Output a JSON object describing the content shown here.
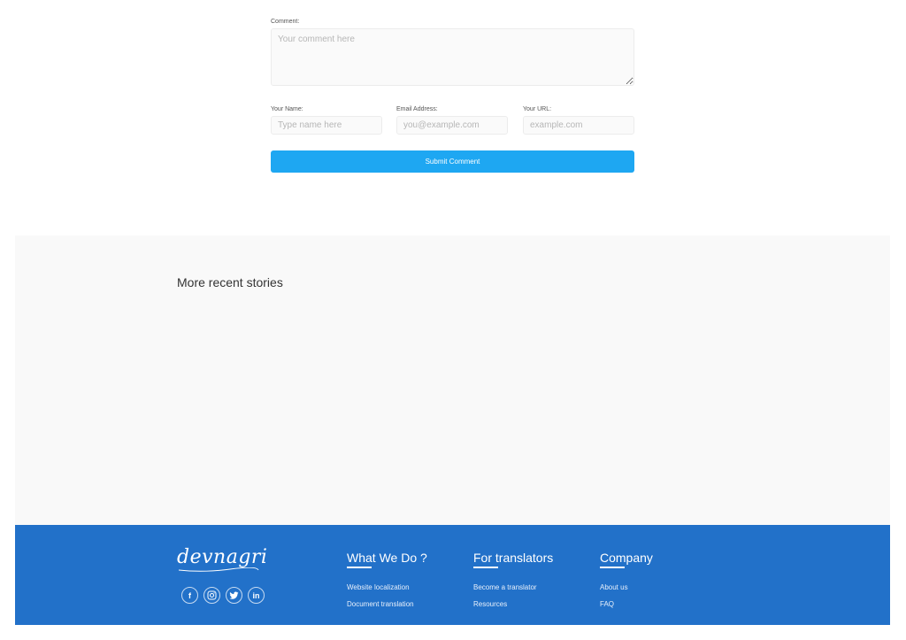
{
  "form": {
    "comment_label": "Comment:",
    "comment_placeholder": "Your comment here",
    "name_label": "Your Name:",
    "name_placeholder": "Type name here",
    "email_label": "Email Address:",
    "email_placeholder": "you@example.com",
    "url_label": "Your URL:",
    "url_placeholder": "example.com",
    "submit_label": "Submit Comment"
  },
  "stories": {
    "title": "More recent stories"
  },
  "footer": {
    "logo_text": "devnagri",
    "social": {
      "facebook": "f",
      "twitter": "t",
      "linkedin": "in"
    },
    "what_we_do": {
      "heading": "What We Do ?",
      "links": [
        "Website localization",
        "Document translation"
      ]
    },
    "for_translators": {
      "heading": "For translators",
      "links": [
        "Become a translator",
        "Resources"
      ]
    },
    "company": {
      "heading": "Company",
      "links": [
        "About us",
        "FAQ"
      ]
    }
  },
  "colors": {
    "primary_button": "#1ea7f2",
    "footer_bg": "#2271c9",
    "section_bg": "#f9f9f9"
  }
}
